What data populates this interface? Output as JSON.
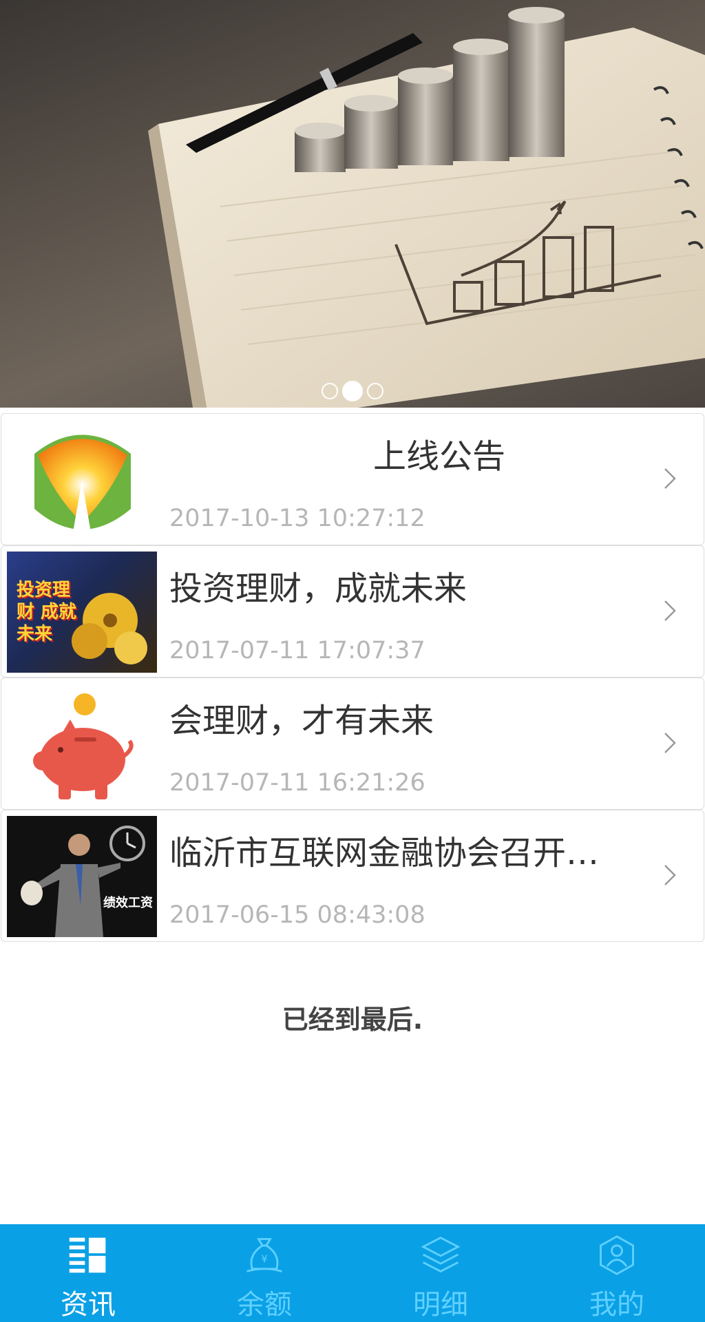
{
  "banner": {
    "slides": 3,
    "active_slide": 2
  },
  "news": [
    {
      "title": "上线公告",
      "date": "2017-10-13 10:27:12",
      "thumb": "sunrise-leaf-logo"
    },
    {
      "title": "投资理财，成就未来",
      "date": "2017-07-11 17:07:37",
      "thumb": "golden-flowers-poster",
      "thumb_text": "投资理财 成就未来"
    },
    {
      "title": "会理财，才有未来",
      "date": "2017-07-11 16:21:26",
      "thumb": "piggy-bank"
    },
    {
      "title": "临沂市互联网金融协会召开…",
      "date": "2017-06-15 08:43:08",
      "thumb": "businessman-clock-poster",
      "thumb_text": "绩效工资"
    }
  ],
  "end_note": "已经到最后.",
  "tabs": [
    {
      "label": "资讯",
      "icon": "news-icon",
      "active": true
    },
    {
      "label": "余额",
      "icon": "money-bag-icon",
      "active": false
    },
    {
      "label": "明细",
      "icon": "layers-icon",
      "active": false
    },
    {
      "label": "我的",
      "icon": "user-profile-icon",
      "active": false
    }
  ],
  "colors": {
    "tabbar": "#0aa0e6",
    "tab_active": "#ffffff",
    "tab_inactive": "#5fd0ff",
    "date_text": "#b6b6b6",
    "title_text": "#333333"
  }
}
